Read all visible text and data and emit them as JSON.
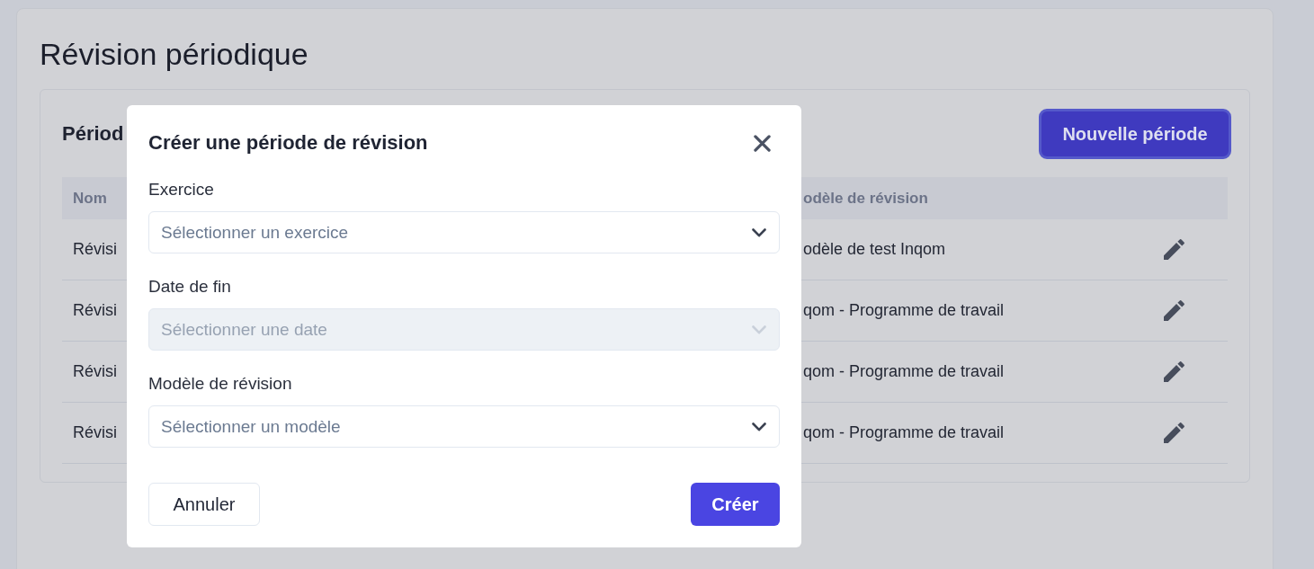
{
  "page": {
    "title": "Révision périodique"
  },
  "panel": {
    "title": "Périod",
    "new_button": {
      "label": "Nouvelle période",
      "focused": true
    }
  },
  "table": {
    "columns": [
      {
        "label": "Nom"
      },
      {
        "label": "odèle de révision"
      }
    ],
    "rows": [
      {
        "name": "Révisi",
        "model": "odèle de test Inqom"
      },
      {
        "name": "Révisi",
        "model": "qom - Programme de travail"
      },
      {
        "name": "Révisi",
        "model": "qom - Programme de travail"
      },
      {
        "name": "Révisi",
        "model": "qom - Programme de travail"
      }
    ]
  },
  "modal": {
    "title": "Créer une période de révision",
    "fields": [
      {
        "label": "Exercice",
        "placeholder": "Sélectionner un exercice",
        "disabled": false
      },
      {
        "label": "Date de fin",
        "placeholder": "Sélectionner une date",
        "disabled": true
      },
      {
        "label": "Modèle de révision",
        "placeholder": "Sélectionner un modèle",
        "disabled": false
      }
    ],
    "cancel": "Annuler",
    "submit": "Créer"
  }
}
